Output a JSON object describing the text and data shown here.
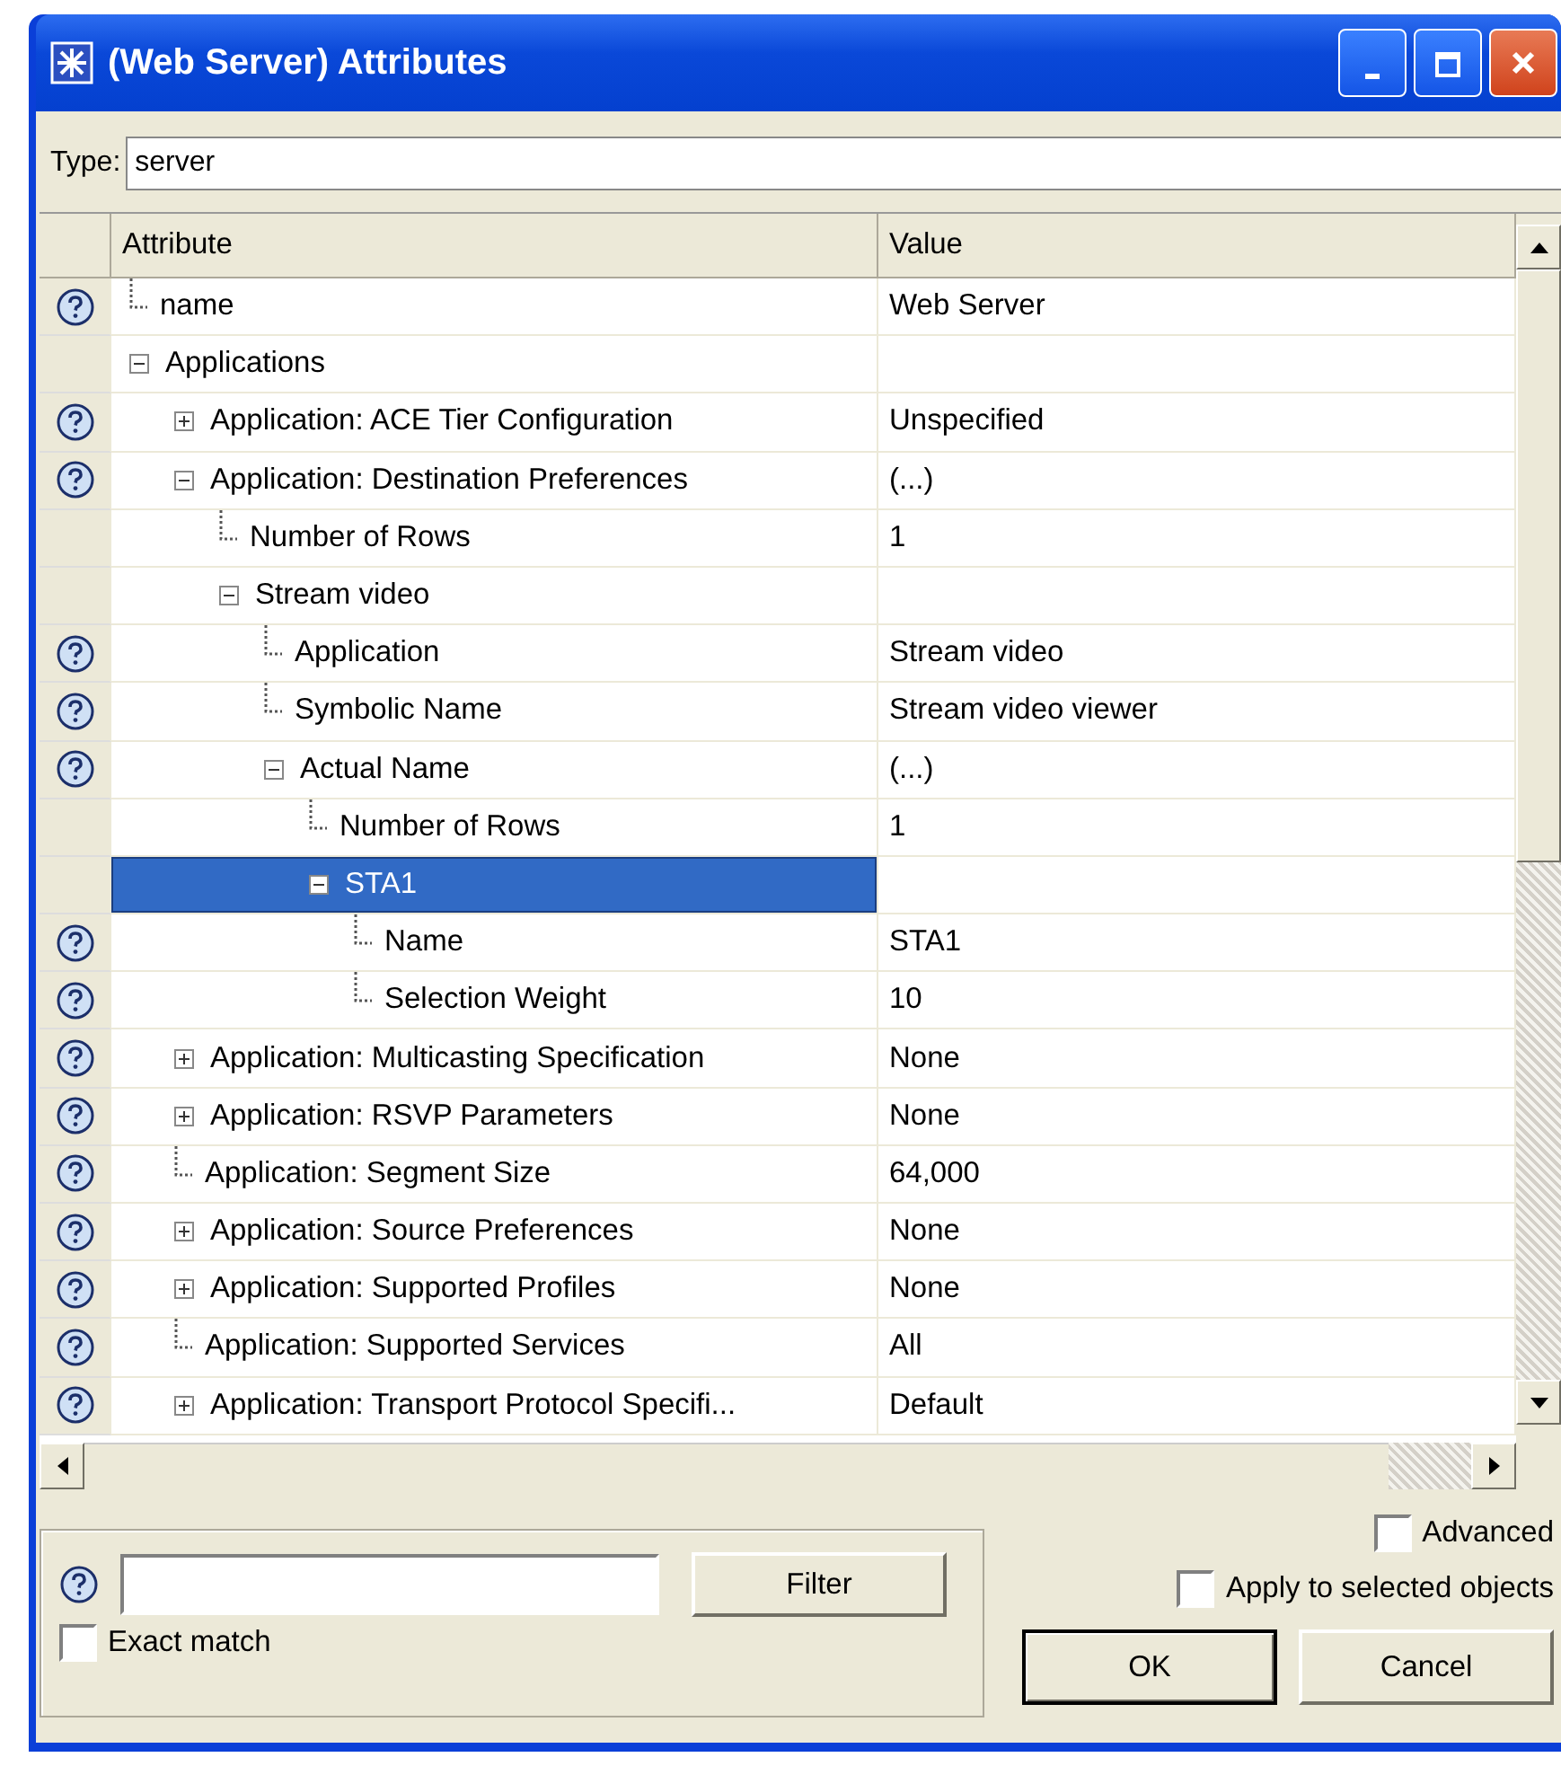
{
  "window": {
    "title": "(Web Server) Attributes"
  },
  "type_field": {
    "label": "Type:",
    "value": "server"
  },
  "table": {
    "columns": [
      "Attribute",
      "Value"
    ],
    "tree": [
      {
        "kind": "leaf",
        "label": "name",
        "value": "Web Server",
        "help": true,
        "selected": false
      },
      {
        "kind": "group",
        "label": "Applications",
        "help": false,
        "expanded": true,
        "selected": false,
        "children": [
          {
            "kind": "group",
            "label": "Application: ACE Tier Configuration",
            "value": "Unspecified",
            "help": true,
            "expanded": false,
            "selected": false
          },
          {
            "kind": "group",
            "label": "Application: Destination Preferences",
            "value": "(...)",
            "help": true,
            "expanded": true,
            "selected": false,
            "children": [
              {
                "kind": "leaf",
                "label": "Number of Rows",
                "value": "1",
                "help": false,
                "selected": false
              },
              {
                "kind": "group",
                "label": "Stream video",
                "help": false,
                "expanded": true,
                "selected": false,
                "children": [
                  {
                    "kind": "leaf",
                    "label": "Application",
                    "value": "Stream video",
                    "help": true,
                    "selected": false
                  },
                  {
                    "kind": "leaf",
                    "label": "Symbolic Name",
                    "value": "Stream video viewer",
                    "help": true,
                    "selected": false
                  },
                  {
                    "kind": "group",
                    "label": "Actual Name",
                    "value": "(...)",
                    "help": true,
                    "expanded": true,
                    "selected": false,
                    "children": [
                      {
                        "kind": "leaf",
                        "label": "Number of Rows",
                        "value": "1",
                        "help": false,
                        "selected": false
                      },
                      {
                        "kind": "group",
                        "label": "STA1",
                        "help": false,
                        "expanded": true,
                        "selected": true,
                        "children": [
                          {
                            "kind": "leaf",
                            "label": "Name",
                            "value": "STA1",
                            "help": true,
                            "selected": false
                          },
                          {
                            "kind": "leaf",
                            "label": "Selection Weight",
                            "value": "10",
                            "help": true,
                            "selected": false
                          }
                        ]
                      }
                    ]
                  }
                ]
              }
            ]
          },
          {
            "kind": "group",
            "label": "Application: Multicasting Specification",
            "value": "None",
            "help": true,
            "expanded": false,
            "selected": false
          },
          {
            "kind": "group",
            "label": "Application: RSVP Parameters",
            "value": "None",
            "help": true,
            "expanded": false,
            "selected": false
          },
          {
            "kind": "leaf",
            "label": "Application: Segment Size",
            "value": "64,000",
            "help": true,
            "selected": false
          },
          {
            "kind": "group",
            "label": "Application: Source Preferences",
            "value": "None",
            "help": true,
            "expanded": false,
            "selected": false
          },
          {
            "kind": "group",
            "label": "Application: Supported Profiles",
            "value": "None",
            "help": true,
            "expanded": false,
            "selected": false
          },
          {
            "kind": "leaf",
            "label": "Application: Supported Services",
            "value": "All",
            "help": true,
            "selected": false
          },
          {
            "kind": "group",
            "label": "Application: Transport Protocol Specifi...",
            "value": "Default",
            "help": true,
            "expanded": false,
            "selected": false
          }
        ]
      }
    ]
  },
  "filter": {
    "button": "Filter",
    "exact_match": {
      "label": "Exact match",
      "checked": false
    }
  },
  "advanced": {
    "label": "Advanced",
    "checked": false
  },
  "apply_selected": {
    "label": "Apply to selected objects",
    "checked": false
  },
  "buttons": [
    "OK",
    "Cancel"
  ]
}
